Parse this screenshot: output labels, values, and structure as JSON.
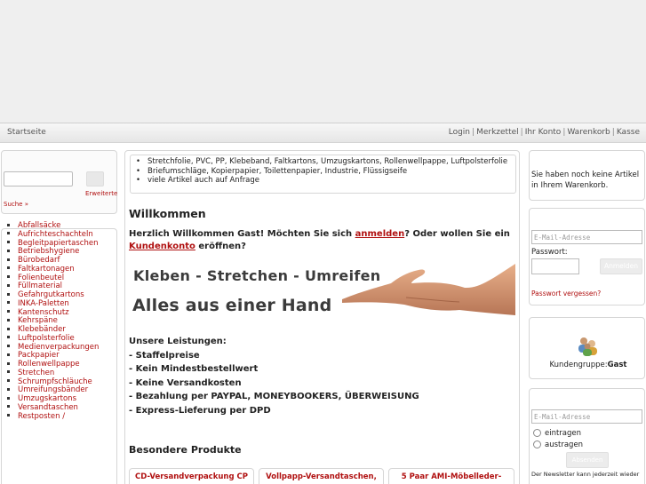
{
  "nav": {
    "home": "Startseite",
    "links": [
      "Login",
      "Merkzettel",
      "Ihr Konto",
      "Warenkorb",
      "Kasse"
    ]
  },
  "search": {
    "advanced_1": "Erweiterte",
    "advanced_2": "Suche »"
  },
  "categories": [
    "Abfallsäcke",
    "Aufrichteschachteln",
    "Begleitpapiertaschen",
    "Betriebshygiene",
    "Bürobedarf",
    "Faltkartonagen",
    "Folienbeutel",
    "Füllmaterial",
    "Gefahrgutkartons",
    "INKA-Paletten",
    "Kantenschutz",
    "Kehrspäne",
    "Klebebänder",
    "Luftpolsterfolie",
    "Medienverpackungen",
    "Packpapier",
    "Rollenwellpappe",
    "Stretchen",
    "Schrumpfschläuche",
    "Umreifungsbänder",
    "Umzugskartons",
    "Versandtaschen",
    "Restposten /"
  ],
  "intro_items": [
    "Stretchfolie, PVC, PP, Klebeband, Faltkartons, Umzugskartons, Rollenwellpappe, Luftpolsterfolie",
    "Briefumschläge, Kopierpapier, Toilettenpapier, Industrie, Flüssigseife",
    "viele Artikel auch auf Anfrage"
  ],
  "welcome": {
    "title": "Willkommen",
    "line1_a": "Herzlich Willkommen Gast! Möchten Sie sich ",
    "login_link": "anmelden",
    "line1_b": "? Oder wollen Sie ein",
    "account_link": "Kundenkonto",
    "line2_b": " eröffnen?"
  },
  "banner": {
    "line1": "Kleben - Stretchen - Umreifen",
    "line2": "Alles aus einer Hand"
  },
  "services": [
    "Unsere Leistungen:",
    "- Staffelpreise",
    "- Kein Mindestbestellwert",
    "- Keine Versandkosten",
    "- Bezahlung per PAYPAL, MONEYBOOKERS, ÜBERWEISUNG",
    "- Express-Lieferung per DPD"
  ],
  "products": {
    "title": "Besondere Produkte",
    "items": [
      "CD-Versandverpackung CP",
      "Vollpapp-Versandtaschen,",
      "5 Paar AMI-Möbelleder-"
    ]
  },
  "cart": {
    "text": "Sie haben noch keine Artikel in Ihrem Warenkorb."
  },
  "login": {
    "email_placeholder": "E-Mail-Adresse",
    "password_label": "Passwort:",
    "forgot": "Passwort vergessen?"
  },
  "group": {
    "label": "Kundengruppe:",
    "value": "Gast"
  },
  "newsletter": {
    "email_placeholder": "E-Mail-Adresse",
    "subscribe": "eintragen",
    "unsubscribe": "austragen",
    "note": "Der Newsletter kann jederzeit wieder"
  },
  "colors": {
    "link": "#b01010",
    "border": "#d6d6d6"
  }
}
